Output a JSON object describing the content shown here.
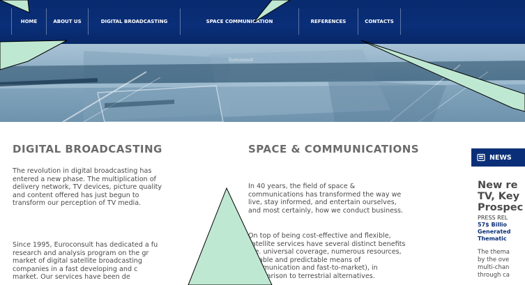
{
  "nav": {
    "items": [
      {
        "label": "HOME"
      },
      {
        "label": "ABOUT US"
      },
      {
        "label": "DIGITAL BROADCASTING"
      },
      {
        "label": "SPACE COMMUNICATION"
      },
      {
        "label": "REFERENCES"
      },
      {
        "label": "CONTACTS"
      }
    ]
  },
  "banner": {
    "tagline": "Euroconsult"
  },
  "digital": {
    "title": "DIGITAL BROADCASTING",
    "para1": [
      "The revolution in digital broadcasting has",
      "entered a new phase. The multiplication of",
      "delivery network, TV devices, picture quality",
      "and content offered has just begun to",
      "transform our perception of TV media."
    ],
    "para2": [
      "Since 1995, Euroconsult has dedicated a fu",
      "research and analysis program on the gr",
      "market of digital satellite broadcasting",
      "companies in a fast developing and c",
      "market. Our services have been de"
    ]
  },
  "space": {
    "title": "SPACE & COMMUNICATIONS",
    "para1": [
      "In 40 years, the field of space &",
      "communications has transformed the way we",
      "live, stay informed, and entertain ourselves,",
      "and most certainly, how we conduct business."
    ],
    "para2": [
      "On top of being cost-effective and flexible,",
      "satellite services have several distinct benefits",
      "(i.e. universal coverage, numerous resources,",
      "reliable and predictable means of",
      "communication and fast-to-market), in",
      "comparison to terrestrial alternatives."
    ]
  },
  "news": {
    "label": "NEWS",
    "headline": [
      "New re",
      "TV, Key",
      "Prospec"
    ],
    "press": "PRESS REL",
    "bold_lines": [
      "57$ Billio",
      "Generated",
      "Thematic"
    ],
    "body": [
      "The thema",
      "by the ove",
      "multi-chan",
      "through ca"
    ]
  },
  "colors": {
    "nav_bg": "#0a2f78",
    "callout_fill": "#bfe8d2",
    "heading_gray": "#6b6b6b"
  }
}
